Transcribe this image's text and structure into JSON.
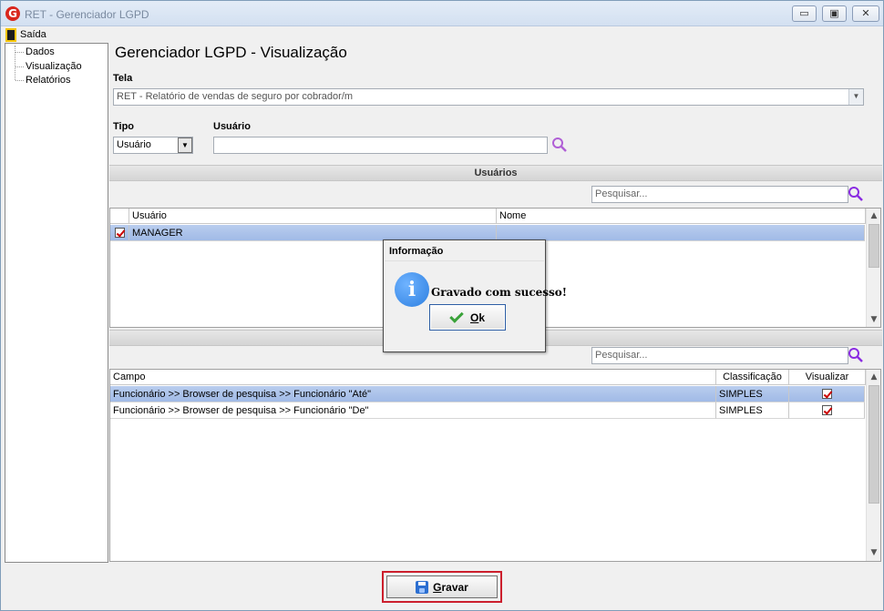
{
  "window": {
    "title": "RET - Gerenciador LGPD",
    "app_icon_letter": "G",
    "minimize_glyph": "▭",
    "maximize_glyph": "▣",
    "close_glyph": "✕"
  },
  "menu": {
    "exit_label": "Saída"
  },
  "sidebar": {
    "items": [
      {
        "label": "Dados"
      },
      {
        "label": "Visualização"
      },
      {
        "label": "Relatórios"
      }
    ]
  },
  "main": {
    "title": "Gerenciador LGPD - Visualização",
    "tela_label": "Tela",
    "tela_value": "RET - Relatório de vendas de seguro por cobrador/m",
    "tipo_label": "Tipo",
    "tipo_value": "Usuário",
    "usuario_label": "Usuário",
    "usuario_value": ""
  },
  "users_section": {
    "title": "Usuários",
    "search_placeholder": "Pesquisar...",
    "columns": [
      "Usuário",
      "Nome"
    ],
    "rows": [
      {
        "checked": true,
        "usuario": "MANAGER",
        "nome": ""
      }
    ]
  },
  "fields_section": {
    "search_placeholder": "Pesquisar...",
    "columns": [
      "Campo",
      "Classificação",
      "Visualizar"
    ],
    "rows": [
      {
        "campo": "Funcionário >> Browser de pesquisa >> Funcionário \"Até\"",
        "classificacao": "SIMPLES",
        "visualizar": true
      },
      {
        "campo": "Funcionário >> Browser de pesquisa >> Funcionário \"De\"",
        "classificacao": "SIMPLES",
        "visualizar": true
      }
    ]
  },
  "dialog": {
    "title": "Informação",
    "message": "Gravado com sucesso!",
    "ok_label_underlined": "O",
    "ok_label_rest": "k",
    "icon_glyph": "i"
  },
  "footer": {
    "save_label_underlined": "G",
    "save_label_rest": "ravar"
  },
  "colors": {
    "selection": "#a9c1eb",
    "save_highlight": "#cc1f2d",
    "search_icon": "#8a2be2",
    "info_icon": "#3b8ef0"
  }
}
